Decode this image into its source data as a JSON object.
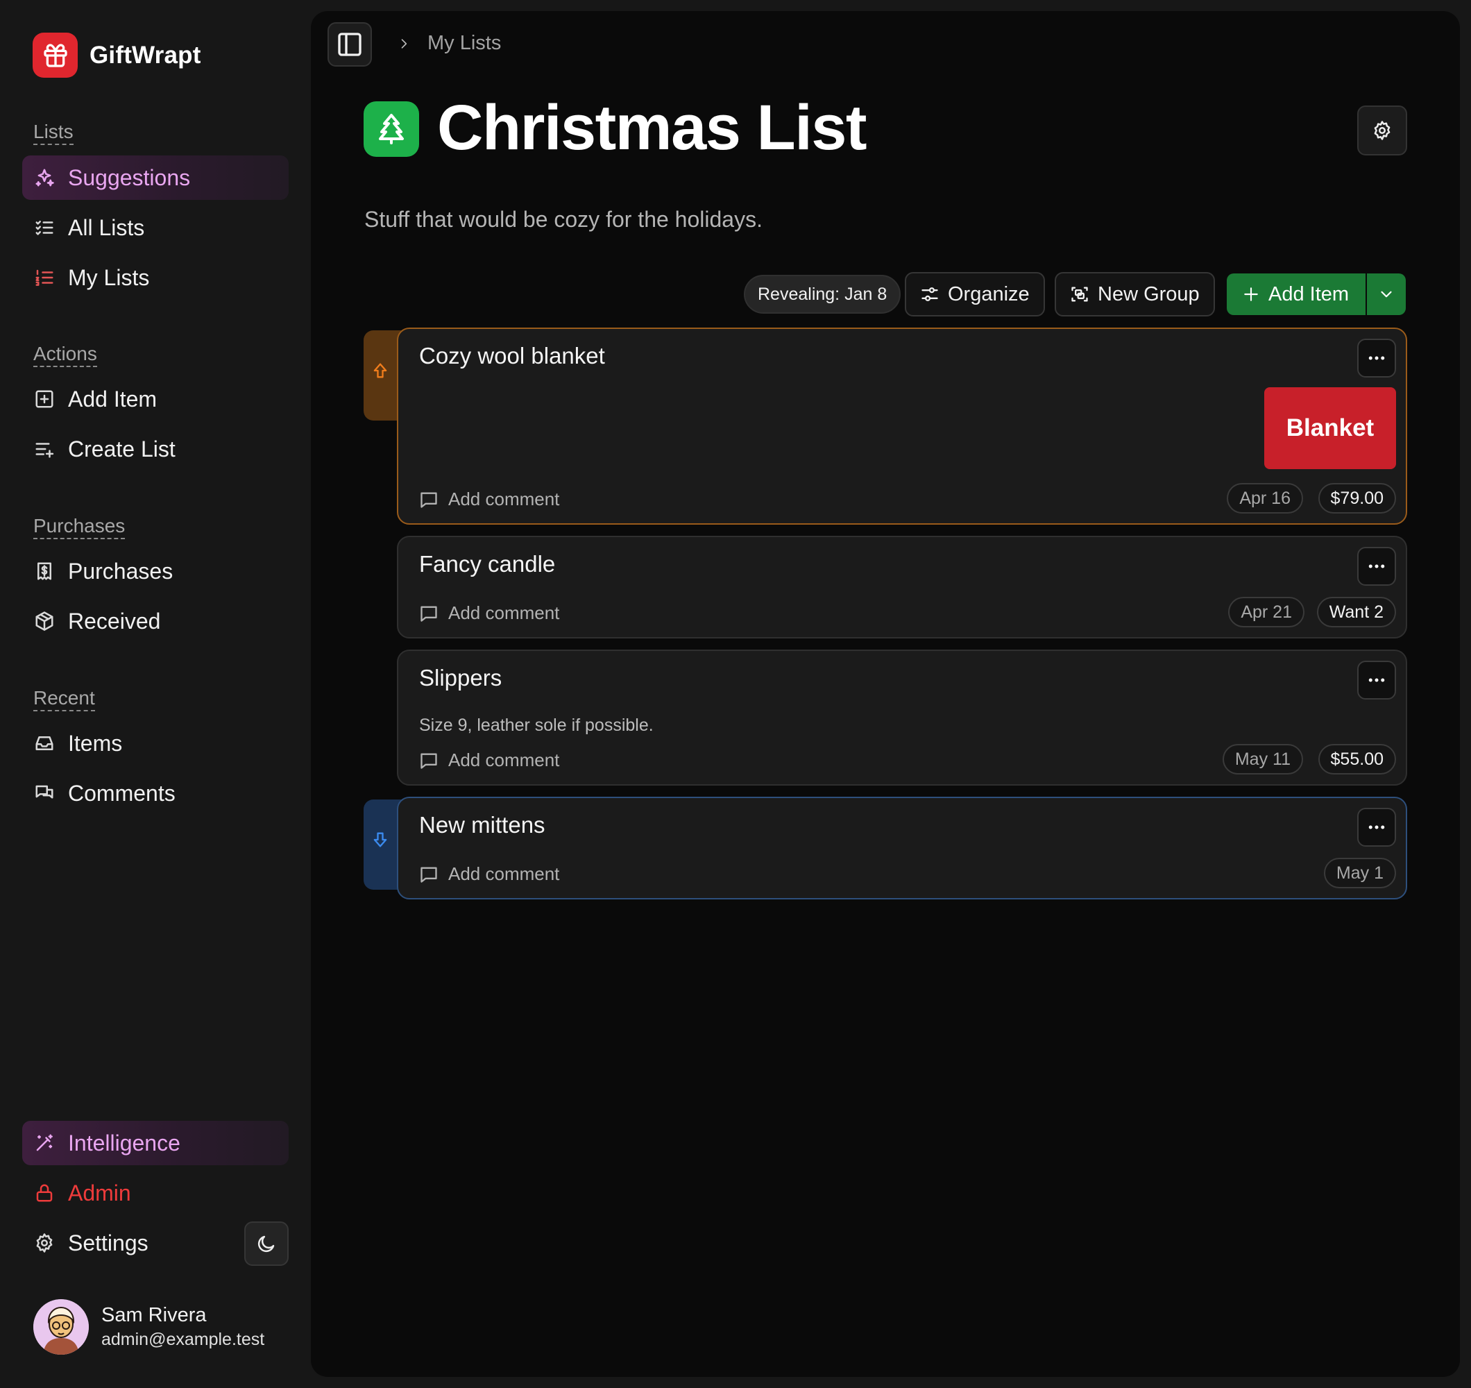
{
  "app": {
    "name": "GiftWrapt"
  },
  "sidebar": {
    "sections": {
      "lists": "Lists",
      "actions": "Actions",
      "purchases": "Purchases",
      "recent": "Recent"
    },
    "lists_items": [
      {
        "label": "Suggestions",
        "icon": "sparkles-icon",
        "active": true
      },
      {
        "label": "All Lists",
        "icon": "list-checks-icon"
      },
      {
        "label": "My Lists",
        "icon": "list-ordered-icon"
      }
    ],
    "action_items": [
      {
        "label": "Add Item",
        "icon": "square-plus-icon"
      },
      {
        "label": "Create List",
        "icon": "list-plus-icon"
      }
    ],
    "purchase_items": [
      {
        "label": "Purchases",
        "icon": "receipt-icon"
      },
      {
        "label": "Received",
        "icon": "package-icon"
      }
    ],
    "recent_items": [
      {
        "label": "Items",
        "icon": "inbox-icon"
      },
      {
        "label": "Comments",
        "icon": "messages-icon"
      }
    ],
    "bottom_items": [
      {
        "label": "Intelligence",
        "icon": "magic-wand-icon"
      },
      {
        "label": "Admin",
        "icon": "lock-icon"
      },
      {
        "label": "Settings",
        "icon": "gear-icon"
      }
    ],
    "user": {
      "name": "Sam Rivera",
      "email": "admin@example.test"
    }
  },
  "breadcrumb": {
    "current": "My Lists"
  },
  "list": {
    "title": "Christmas List",
    "description": "Stuff that would be cozy for the holidays.",
    "icon": "tree-icon",
    "accent": "#1db14a"
  },
  "toolbar": {
    "reveal": "Revealing: Jan 8",
    "organize": "Organize",
    "new_group": "New Group",
    "add_item": "Add Item"
  },
  "items": [
    {
      "title": "Cozy wool blanket",
      "priority": "high",
      "image_label": "Blanket",
      "comment_label": "Add comment",
      "date": "Apr 16",
      "value": "$79.00"
    },
    {
      "title": "Fancy candle",
      "priority": "normal",
      "comment_label": "Add comment",
      "date": "Apr 21",
      "value": "Want 2"
    },
    {
      "title": "Slippers",
      "priority": "normal",
      "note": "Size 9, leather sole if possible.",
      "comment_label": "Add comment",
      "date": "May 11",
      "value": "$55.00"
    },
    {
      "title": "New mittens",
      "priority": "low",
      "comment_label": "Add comment",
      "date": "May 1"
    }
  ],
  "colors": {
    "brand": "#e0262e",
    "active_nav": "#e9a6f0",
    "admin": "#ee3b3b",
    "add_button": "#1b7a35",
    "priority_high": "#f07d1c",
    "priority_low": "#3b8bef"
  }
}
